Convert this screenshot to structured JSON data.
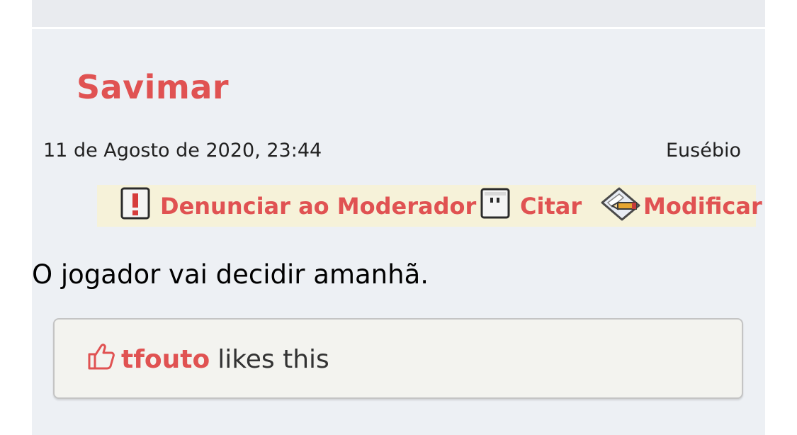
{
  "post": {
    "author": "Savimar",
    "date": "11 de Agosto de 2020, 23:44",
    "board": "Eusébio",
    "actions": {
      "report_label": "Denunciar ao Moderador",
      "quote_label": "Citar",
      "edit_label": "Modificar"
    },
    "message": "O jogador vai decidir amanhã.",
    "likes": {
      "user": "tfouto",
      "suffix": "likes this"
    }
  },
  "colors": {
    "accent": "#e05252",
    "post_background": "#edf0f4",
    "action_bar_background": "#f6f2d9",
    "likes_background": "#f3f3ef"
  },
  "icons": {
    "report": "report-exclamation-icon",
    "quote": "quote-icon",
    "edit": "edit-pencil-icon",
    "like": "thumbs-up-icon"
  }
}
